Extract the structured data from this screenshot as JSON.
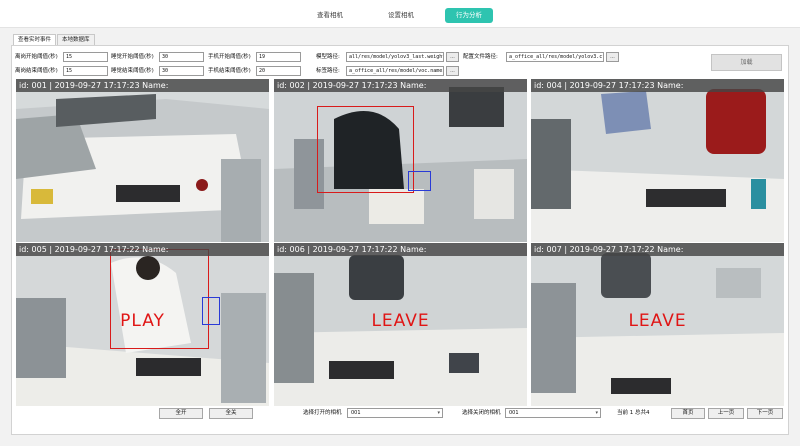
{
  "topnav": {
    "items": [
      {
        "label": "查看相机",
        "active": false
      },
      {
        "label": "设置相机",
        "active": false
      },
      {
        "label": "行为分析",
        "active": true
      }
    ],
    "accent_color": "#2ec4b0"
  },
  "tabs": [
    {
      "label": "查看实时事件",
      "active": true
    },
    {
      "label": "本地数据库",
      "active": false
    }
  ],
  "params": {
    "seat_start": {
      "label": "离岗开始阈值(秒)",
      "value": "15"
    },
    "seat_end": {
      "label": "离岗结束阈值(秒)",
      "value": "15"
    },
    "sleep_start": {
      "label": "睡觉开始阈值(秒)",
      "value": "30"
    },
    "sleep_end": {
      "label": "睡觉结束阈值(秒)",
      "value": "30"
    },
    "phone_start": {
      "label": "手机开始阈值(秒)",
      "value": "19"
    },
    "phone_end": {
      "label": "手机结束阈值(秒)",
      "value": "20"
    },
    "model_path": {
      "label": "模型路径:",
      "value": "all/res/model/yolov3_last.weights"
    },
    "config_path": {
      "label": "配置文件路径:",
      "value": "a_office_all/res/model/yolov3.cfg"
    },
    "label_path": {
      "label": "标签路径:",
      "value": "a_office_all/res/model/voc.names"
    },
    "browse_label": "...",
    "load_label": "加载"
  },
  "cameras": [
    {
      "header": "id: 001 | 2019-09-27 17:17:23 Name:",
      "event": ""
    },
    {
      "header": "id: 002 | 2019-09-27 17:17:23 Name:",
      "event": ""
    },
    {
      "header": "id: 004 | 2019-09-27 17:17:23 Name:",
      "event": ""
    },
    {
      "header": "id: 005 | 2019-09-27 17:17:22 Name:",
      "event": "PLAY"
    },
    {
      "header": "id: 006 | 2019-09-27 17:17:22 Name:",
      "event": "LEAVE"
    },
    {
      "header": "id: 007 | 2019-09-27 17:17:22 Name:",
      "event": "LEAVE"
    }
  ],
  "event_color": "#e01515",
  "bottom": {
    "open_all": "全开",
    "close_all": "全关",
    "select_open_label": "选择打开的相机",
    "select_open_value": "001",
    "select_close_label": "选择关闭的相机",
    "select_close_value": "001",
    "page_info": "当前 1 总共4",
    "first_page": "首页",
    "prev_page": "上一页",
    "next_page": "下一页"
  }
}
